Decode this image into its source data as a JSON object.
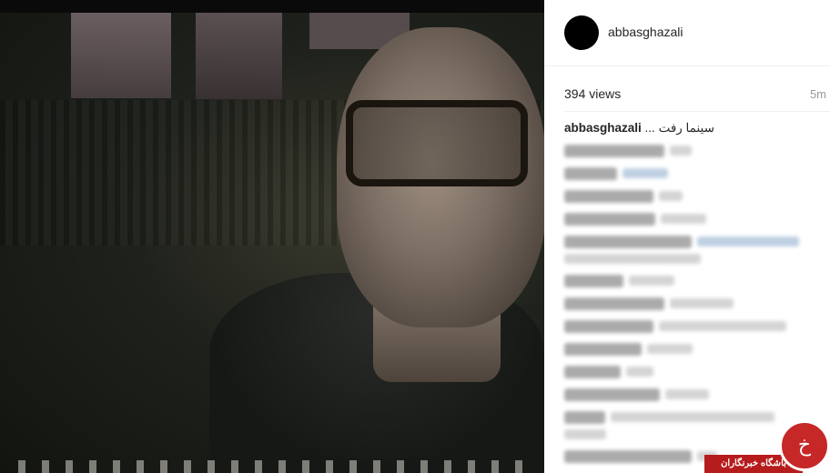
{
  "post": {
    "username": "abbasghazali",
    "views": "394 views",
    "time": "5m",
    "caption_user": "abbasghazali",
    "caption_text": "... سینما رفت"
  },
  "comments": [
    {
      "blurred": true
    },
    {
      "blurred": true
    },
    {
      "blurred": true
    },
    {
      "blurred": true
    },
    {
      "blurred": true
    },
    {
      "blurred": true,
      "two_lines": true
    },
    {
      "blurred": true
    },
    {
      "blurred": true
    },
    {
      "blurred": true
    },
    {
      "blurred": true
    },
    {
      "blurred": true
    },
    {
      "blurred": true
    },
    {
      "blurred": true
    },
    {
      "blurred": true
    },
    {
      "blurred": true
    }
  ],
  "watermark": {
    "band_text": "باشگاه خبرنگاران",
    "logo_glyph": "خ"
  },
  "colors": {
    "username": "#262626",
    "meta": "#999999",
    "watermark_red": "#b71c1c"
  }
}
